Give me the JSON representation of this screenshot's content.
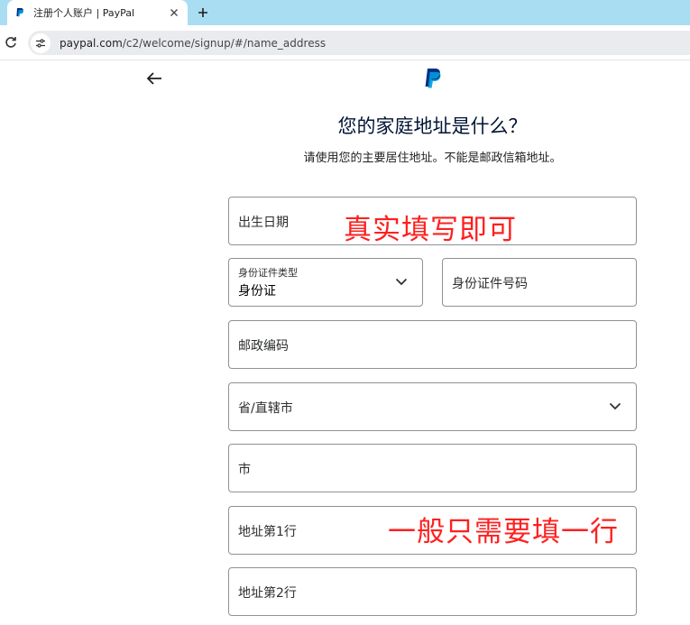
{
  "browser": {
    "tab_title": "注册个人账户 | PayPal",
    "url_host": "paypal.com",
    "url_path": "/c2/welcome/signup/#/name_address"
  },
  "page": {
    "title": "您的家庭地址是什么？",
    "subtitle": "请使用您的主要居住地址。不能是邮政信箱地址。"
  },
  "form": {
    "birth_date_label": "出生日期",
    "id_type_label": "身份证件类型",
    "id_type_value": "身份证",
    "id_number_label": "身份证件号码",
    "postal_code_label": "邮政编码",
    "province_label": "省/直辖市",
    "city_label": "市",
    "address_line1_label": "地址第1行",
    "address_line2_label": "地址第2行"
  },
  "annotations": {
    "note1": "真实填写即可",
    "note2": "一般只需要填一行"
  },
  "colors": {
    "tabbar": "#a9def2",
    "paypal_dark_blue": "#003087",
    "paypal_light_blue": "#009cde",
    "annotation_red": "#ff1f1f",
    "field_border": "#8f9195"
  },
  "icons": [
    "paypal-favicon-icon",
    "close-icon",
    "plus-icon",
    "reload-icon",
    "site-settings-icon",
    "back-arrow-icon",
    "paypal-logo",
    "chevron-down-icon"
  ]
}
